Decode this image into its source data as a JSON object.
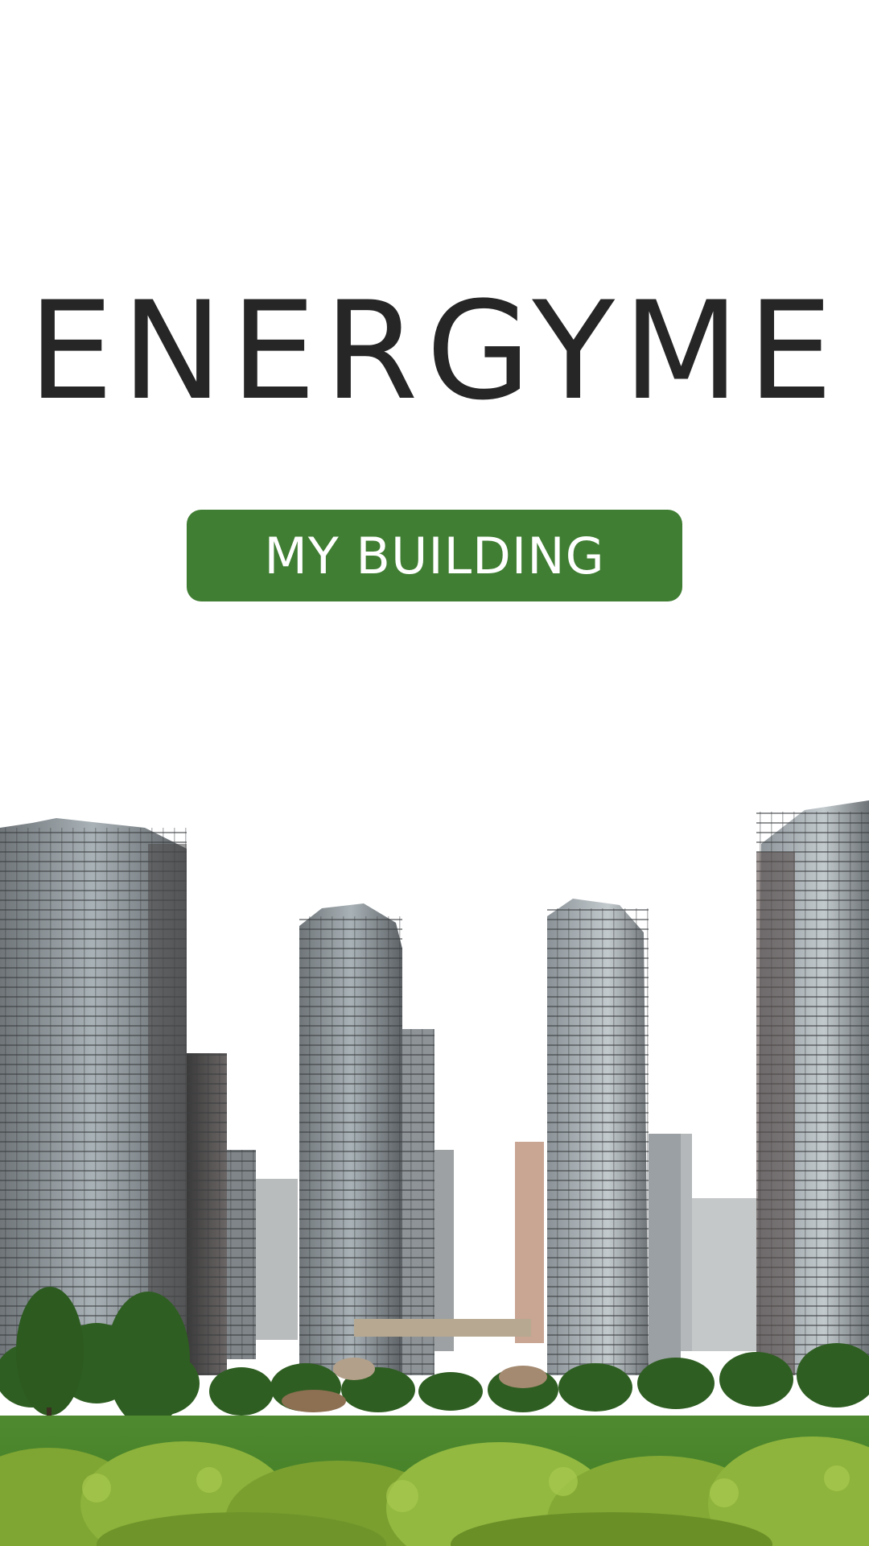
{
  "app": {
    "title": "ENERGYME"
  },
  "actions": {
    "my_building_label": "MY BUILDING"
  },
  "theme": {
    "primary_color": "#407e33",
    "title_color": "#262626",
    "background": "#ffffff"
  },
  "hero": {
    "image_subject": "city-towers-park-image"
  }
}
